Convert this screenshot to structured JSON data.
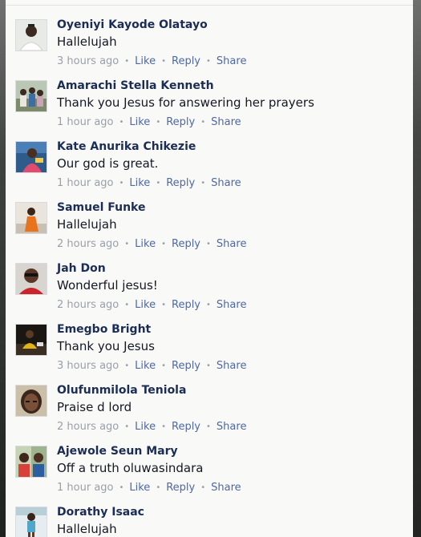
{
  "comments": [
    {
      "name": "Oyeniyi Kayode Olatayo",
      "text": "Hallelujah",
      "time": "3 hours ago",
      "like": "Like",
      "reply": "Reply",
      "share": "Share",
      "avatar": "avatar-man-white-shirt"
    },
    {
      "name": "Amarachi Stella Kenneth",
      "text": "Thank you Jesus for answering her prayers",
      "time": "1 hour ago",
      "like": "Like",
      "reply": "Reply",
      "share": "Share",
      "avatar": "avatar-group-photo"
    },
    {
      "name": "Kate Anurika Chikezie",
      "text": "Our god is great.",
      "time": "1 hour ago",
      "like": "Like",
      "reply": "Reply",
      "share": "Share",
      "avatar": "avatar-woman-blue"
    },
    {
      "name": "Samuel Funke",
      "text": "Hallelujah",
      "time": "2 hours ago",
      "like": "Like",
      "reply": "Reply",
      "share": "Share",
      "avatar": "avatar-woman-orange"
    },
    {
      "name": "Jah Don",
      "text": "Wonderful jesus!",
      "time": "2 hours ago",
      "like": "Like",
      "reply": "Reply",
      "share": "Share",
      "avatar": "avatar-man-red"
    },
    {
      "name": "Emegbo Bright",
      "text": "Thank you Jesus",
      "time": "3 hours ago",
      "like": "Like",
      "reply": "Reply",
      "share": "Share",
      "avatar": "avatar-man-dark-room"
    },
    {
      "name": "Olufunmilola Teniola",
      "text": "Praise d lord",
      "time": "2 hours ago",
      "like": "Like",
      "reply": "Reply",
      "share": "Share",
      "avatar": "avatar-woman-closeup"
    },
    {
      "name": "Ajewole Seun Mary",
      "text": "Off a truth oluwasindara",
      "time": "1 hour ago",
      "like": "Like",
      "reply": "Reply",
      "share": "Share",
      "avatar": "avatar-two-people"
    },
    {
      "name": "Dorathy Isaac",
      "text": "Hallelujah",
      "time": "",
      "like": "",
      "reply": "",
      "share": "",
      "avatar": "avatar-woman-standing"
    }
  ],
  "colors": {
    "name": "#1b2d55",
    "text": "#141823",
    "action": "#4e69a2",
    "meta": "#9aa0ab",
    "background": "#f9f9f7"
  }
}
